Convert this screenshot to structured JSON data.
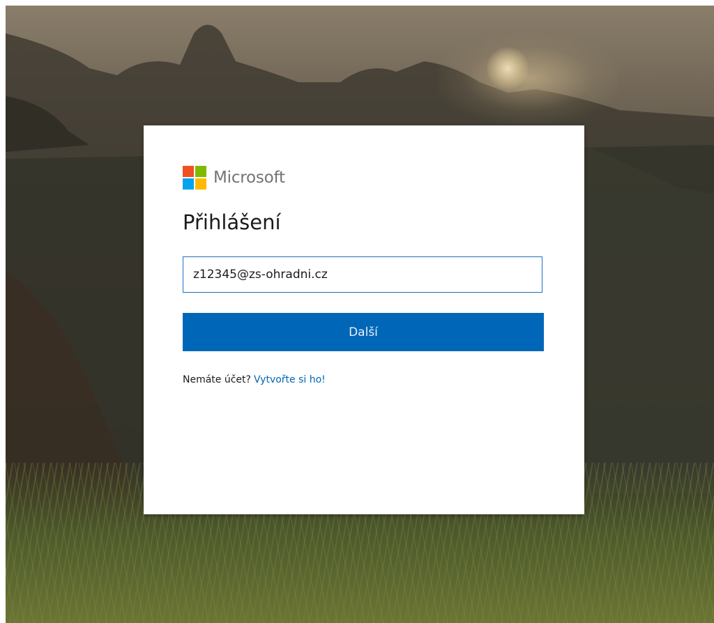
{
  "brand": {
    "name": "Microsoft",
    "logo_colors": [
      "#f25022",
      "#7fba00",
      "#00a4ef",
      "#ffb900"
    ]
  },
  "title": "Přihlášení",
  "email_field": {
    "value": "z12345@zs-ohradni.cz"
  },
  "next_button": {
    "label": "Další"
  },
  "signup": {
    "prompt": "Nemáte účet?",
    "link_text": "Vytvořte si ho!"
  },
  "colors": {
    "accent": "#0067b8",
    "input_border": "#1f6fbf",
    "card_background": "#ffffff"
  }
}
